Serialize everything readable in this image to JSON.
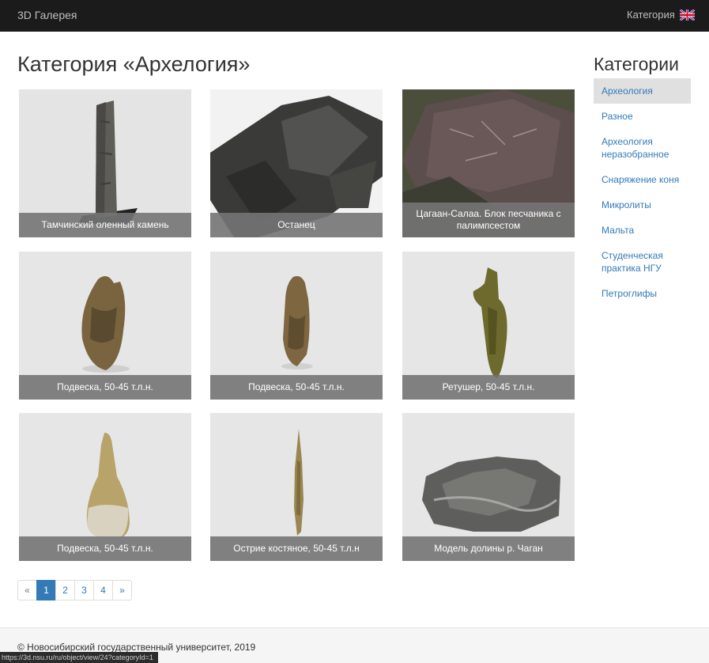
{
  "navbar": {
    "brand": "3D Галерея",
    "category_label": "Категория",
    "flag_icon": "uk-flag-icon"
  },
  "page_title": "Категория «Архелогия»",
  "gallery": [
    {
      "caption": "Тамчинский оленный камень"
    },
    {
      "caption": "Останец"
    },
    {
      "caption": "Цагаан-Салаа. Блок песчаника с палимпсестом"
    },
    {
      "caption": "Подвеска, 50-45 т.л.н."
    },
    {
      "caption": "Подвеска, 50-45 т.л.н."
    },
    {
      "caption": "Ретушер, 50-45 т.л.н."
    },
    {
      "caption": "Подвеска, 50-45 т.л.н."
    },
    {
      "caption": "Острие костяное, 50-45 т.л.н"
    },
    {
      "caption": "Модель долины р. Чаган"
    }
  ],
  "pagination": {
    "prev": "«",
    "pages": [
      "1",
      "2",
      "3",
      "4"
    ],
    "next": "»",
    "current": "1"
  },
  "sidebar": {
    "title": "Категории",
    "items": [
      {
        "label": "Археология",
        "active": true
      },
      {
        "label": "Разное"
      },
      {
        "label": "Археология неразобранное"
      },
      {
        "label": "Снаряжение коня"
      },
      {
        "label": "Микролиты"
      },
      {
        "label": "Мальта"
      },
      {
        "label": "Студенческая практика НГУ"
      },
      {
        "label": "Петроглифы"
      }
    ]
  },
  "footer": {
    "text": "© Новосибирский государственный университет, 2019"
  },
  "status_url": "https://3d.nsu.ru/ru/object/view/24?categoryId=1",
  "colors": {
    "navbar": "#1b1b1b",
    "link": "#337ab7",
    "caption_bg": "#747474"
  }
}
